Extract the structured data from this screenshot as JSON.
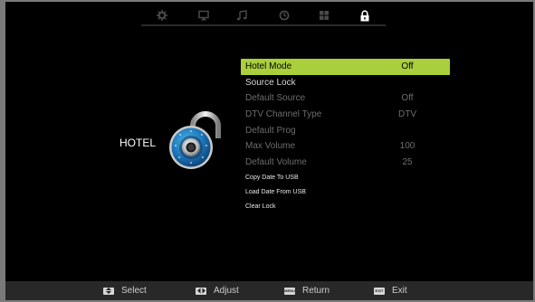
{
  "hotel_menu": {
    "title": "HOTEL",
    "tabs": [
      {
        "icon": "gear-icon",
        "active": false
      },
      {
        "icon": "monitor-icon",
        "active": false
      },
      {
        "icon": "music-note-icon",
        "active": false
      },
      {
        "icon": "clock-icon",
        "active": false
      },
      {
        "icon": "grid-icon",
        "active": false
      },
      {
        "icon": "lock-icon",
        "active": true
      }
    ],
    "items": [
      {
        "label": "Hotel Mode",
        "value": "Off",
        "state": "selected"
      },
      {
        "label": "Source Lock",
        "value": "",
        "state": "enabled"
      },
      {
        "label": "Default Source",
        "value": "Off",
        "state": "disabled"
      },
      {
        "label": "DTV Channel Type",
        "value": "DTV",
        "state": "disabled"
      },
      {
        "label": "Default Prog",
        "value": "",
        "state": "disabled"
      },
      {
        "label": "Max Volume",
        "value": "100",
        "state": "disabled"
      },
      {
        "label": "Default Volume",
        "value": "25",
        "state": "disabled"
      },
      {
        "label": "Copy Date To USB",
        "value": "",
        "state": "small"
      },
      {
        "label": "Load Date From USB",
        "value": "",
        "state": "small"
      },
      {
        "label": "Clear Lock",
        "value": "",
        "state": "small"
      }
    ],
    "colors": {
      "highlight": "#a9cf3c",
      "background": "#000000",
      "footer": "#282828"
    }
  },
  "footer": {
    "select": {
      "key": "",
      "label": "Select"
    },
    "adjust": {
      "key": "",
      "label": "Adjust"
    },
    "return": {
      "key": "MENU",
      "label": "Return"
    },
    "exit": {
      "key": "EXIT",
      "label": "Exit"
    }
  }
}
